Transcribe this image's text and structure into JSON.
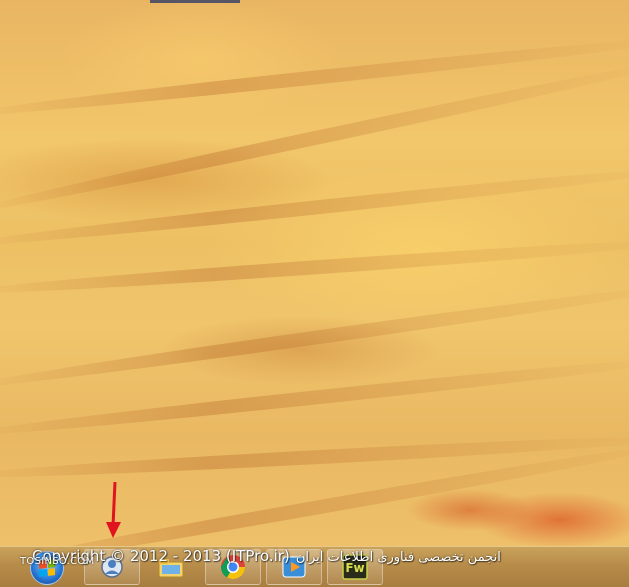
{
  "watermark": {
    "copyright": "Copyright © 2012 - 2013 (ITPro.ir)",
    "persian": "انجمن تخصصی فناوری اطلاعات ایران",
    "brand": "TOSINSO.COM"
  },
  "taskbar": {
    "items": [
      {
        "icon": "start-orb-icon"
      },
      {
        "icon": "user-account-icon"
      },
      {
        "icon": "file-explorer-icon"
      },
      {
        "icon": "chrome-icon"
      },
      {
        "icon": "media-player-icon"
      },
      {
        "icon": "fireworks-icon",
        "text": "Fw"
      }
    ]
  },
  "colors": {
    "taskbar": "#b68a48",
    "arrow": "#e0141e",
    "desktop": "#f0c56c"
  }
}
